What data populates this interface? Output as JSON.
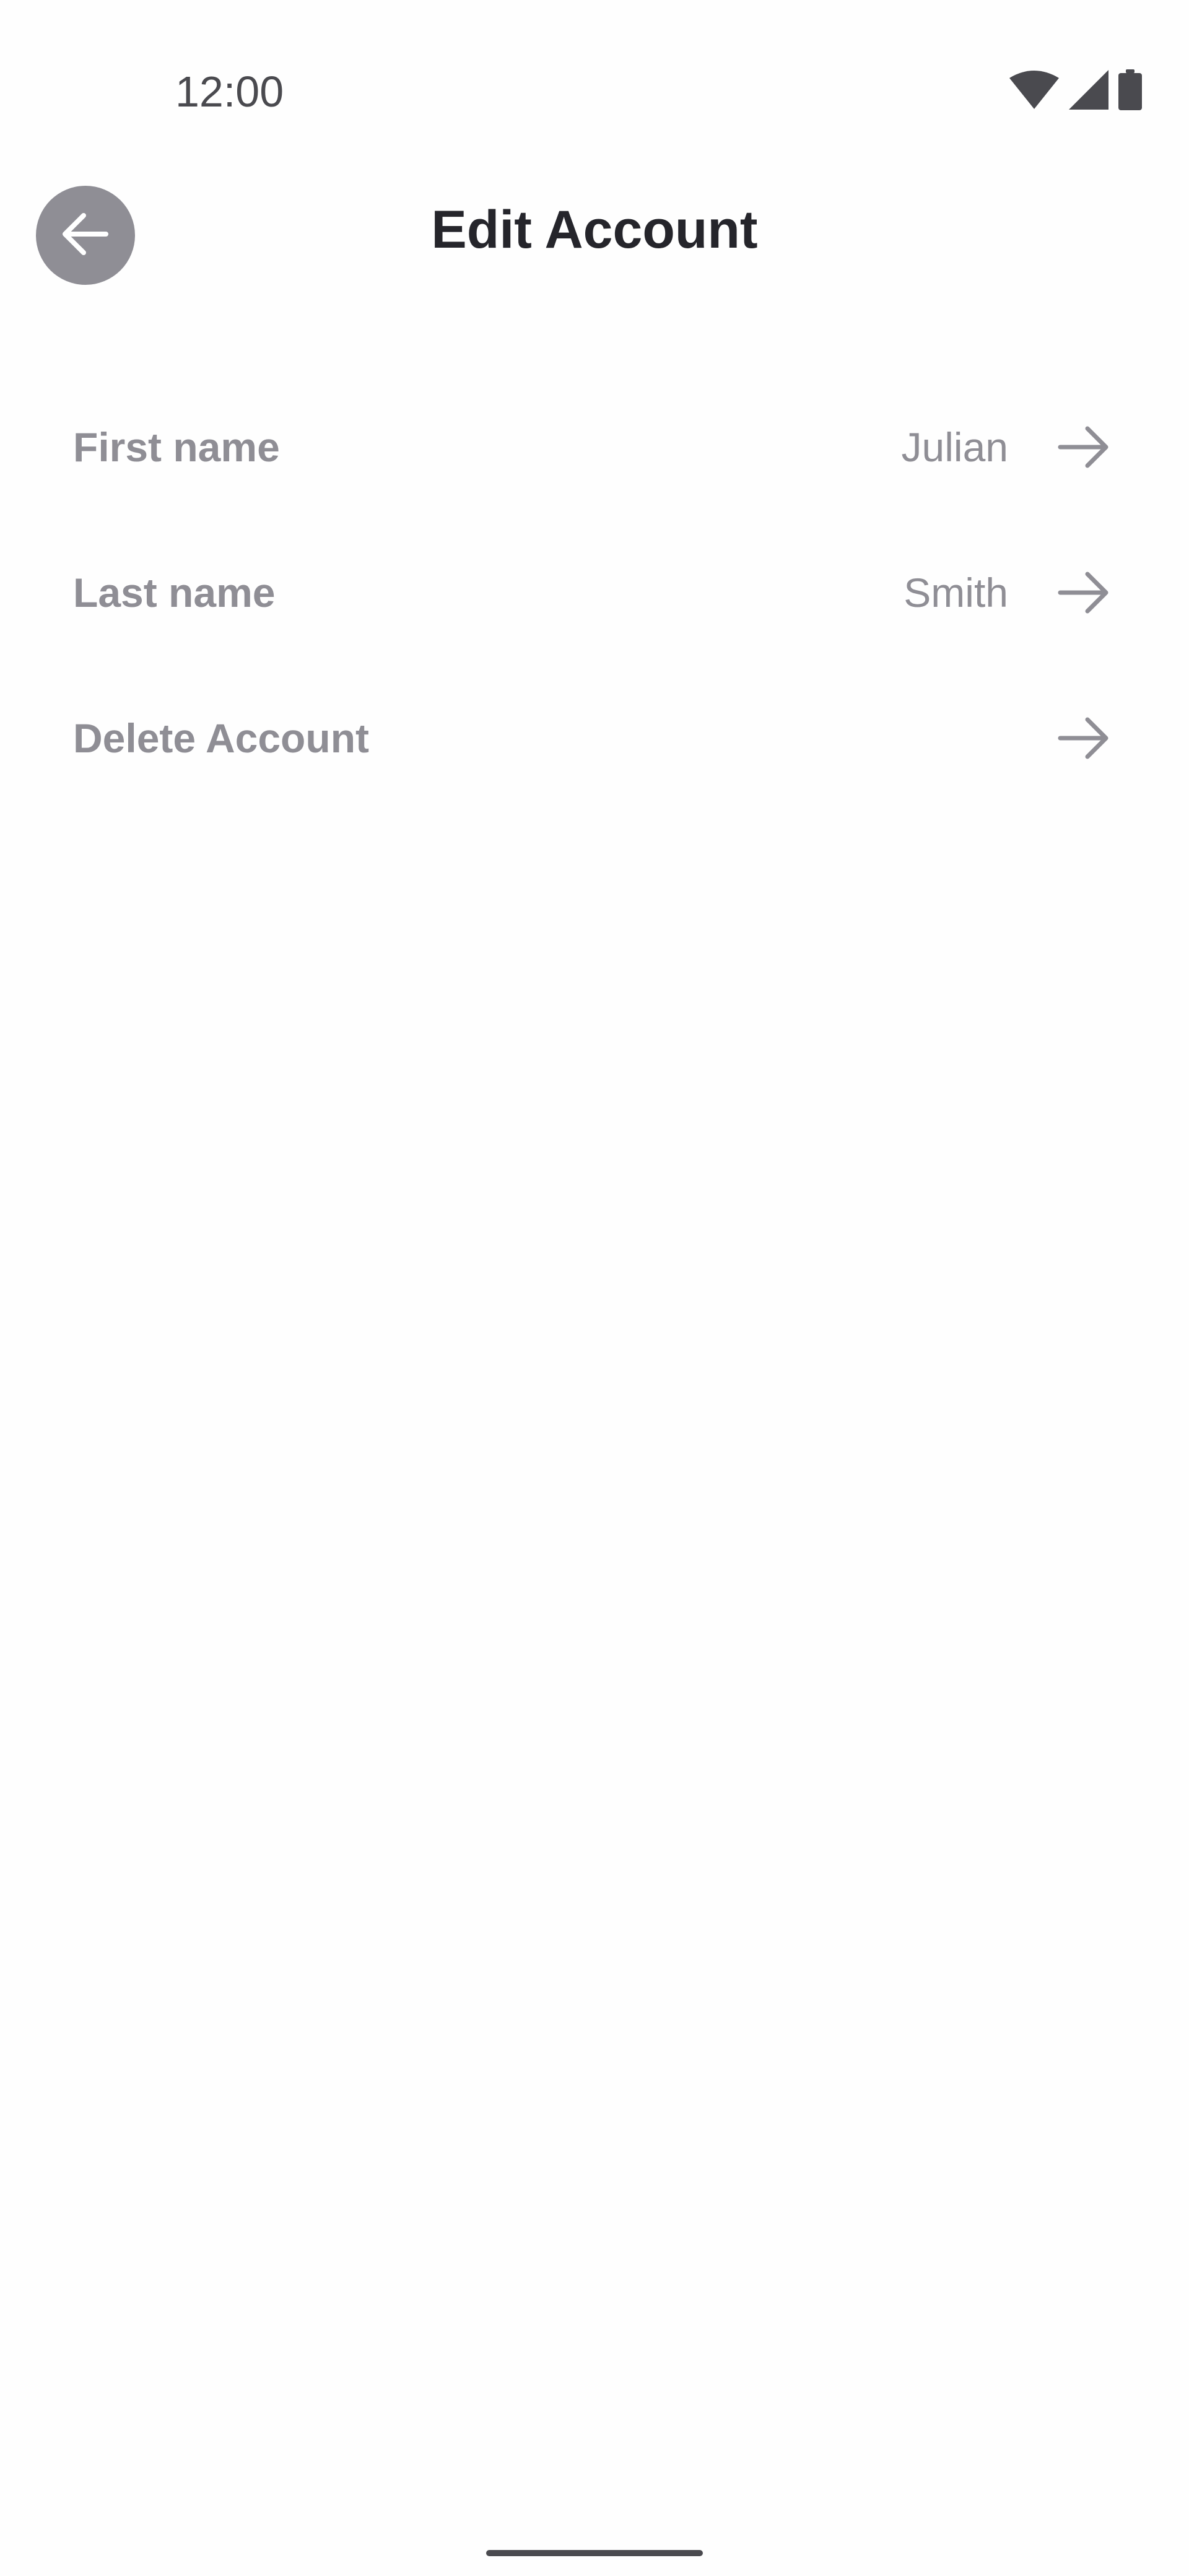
{
  "status_bar": {
    "time": "12:00",
    "icons": [
      "wifi-icon",
      "cellular-signal-icon",
      "battery-icon"
    ]
  },
  "header": {
    "title": "Edit Account",
    "back_icon": "arrow-left-icon"
  },
  "rows": [
    {
      "label": "First name",
      "value": "Julian",
      "icon": "arrow-right-icon"
    },
    {
      "label": "Last name",
      "value": "Smith",
      "icon": "arrow-right-icon"
    },
    {
      "label": "Delete Account",
      "value": "",
      "icon": "arrow-right-icon"
    }
  ],
  "colors": {
    "background": "#fefefe",
    "title_text": "#25252b",
    "secondary_text": "#8f8e95",
    "back_button_bg": "#8f8e95",
    "status_text": "#4a4a4f"
  }
}
